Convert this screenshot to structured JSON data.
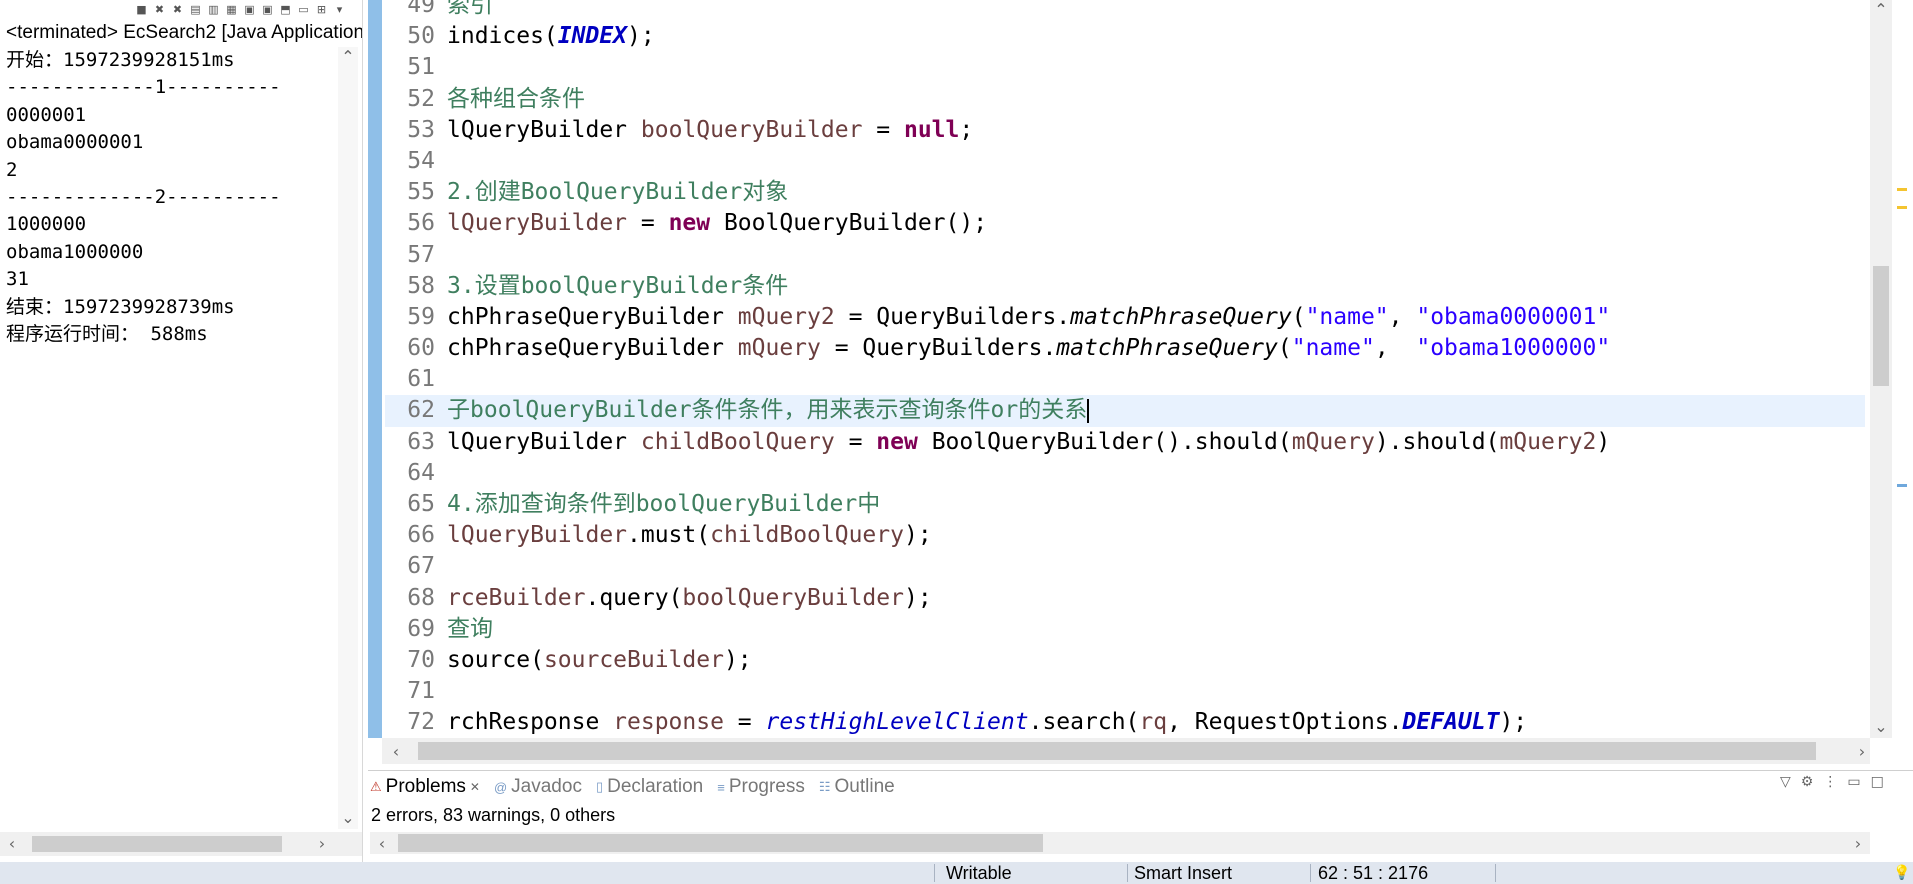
{
  "console": {
    "title": "<terminated> EcSearch2 [Java Application",
    "toolbar_icons": [
      "terminate-icon",
      "remove-launch-icon",
      "remove-all-icon",
      "clear-console-icon",
      "scroll-lock-icon",
      "word-wrap-icon",
      "show-on-output-icon",
      "show-on-error-icon",
      "pin-console-icon",
      "display-selected-icon",
      "open-console-icon",
      "view-menu-icon"
    ],
    "lines": [
      "开始：1597239928151ms",
      "-------------1----------",
      "0000001",
      "obama0000001",
      "2",
      "-------------2----------",
      "1000000",
      "obama1000000",
      "31",
      "结束：1597239928739ms",
      "程序运行时间： 588ms"
    ]
  },
  "editor": {
    "current_line": "62",
    "lines": [
      {
        "n": "49",
        "p": [
          [
            "cm",
            "索引"
          ]
        ]
      },
      {
        "n": "50",
        "p": [
          [
            "tx",
            "indices("
          ],
          [
            "sfld",
            "INDEX"
          ],
          [
            "tx",
            ");"
          ]
        ]
      },
      {
        "n": "51",
        "p": []
      },
      {
        "n": "52",
        "p": [
          [
            "cm",
            "各种组合条件"
          ]
        ]
      },
      {
        "n": "53",
        "p": [
          [
            "tx",
            "lQueryBuilder "
          ],
          [
            "var",
            "boolQueryBuilder"
          ],
          [
            "tx",
            " = "
          ],
          [
            "kw",
            "null"
          ],
          [
            "tx",
            ";"
          ]
        ]
      },
      {
        "n": "54",
        "p": []
      },
      {
        "n": "55",
        "p": [
          [
            "cm",
            "2.创建BoolQueryBuilder对象"
          ]
        ]
      },
      {
        "n": "56",
        "p": [
          [
            "var",
            "lQueryBuilder"
          ],
          [
            "tx",
            " = "
          ],
          [
            "kw",
            "new"
          ],
          [
            "tx",
            " BoolQueryBuilder();"
          ]
        ]
      },
      {
        "n": "57",
        "p": []
      },
      {
        "n": "58",
        "p": [
          [
            "cm",
            "3.设置boolQueryBuilder条件"
          ]
        ]
      },
      {
        "n": "59",
        "p": [
          [
            "tx",
            "chPhraseQueryBuilder "
          ],
          [
            "var",
            "mQuery2"
          ],
          [
            "tx",
            " = QueryBuilders."
          ],
          [
            "it",
            "matchPhraseQuery"
          ],
          [
            "tx",
            "("
          ],
          [
            "st",
            "\"name\""
          ],
          [
            "tx",
            ", "
          ],
          [
            "st",
            "\"obama0000001\""
          ]
        ]
      },
      {
        "n": "60",
        "p": [
          [
            "tx",
            "chPhraseQueryBuilder "
          ],
          [
            "var",
            "mQuery"
          ],
          [
            "tx",
            " = QueryBuilders."
          ],
          [
            "it",
            "matchPhraseQuery"
          ],
          [
            "tx",
            "("
          ],
          [
            "st",
            "\"name\""
          ],
          [
            "tx",
            ",  "
          ],
          [
            "st",
            "\"obama1000000\""
          ]
        ]
      },
      {
        "n": "61",
        "p": []
      },
      {
        "n": "62",
        "p": [
          [
            "cm",
            "子boolQueryBuilder条件条件，用来表示查询条件or的关系"
          ],
          [
            "caret",
            ""
          ]
        ]
      },
      {
        "n": "63",
        "p": [
          [
            "tx",
            "lQueryBuilder "
          ],
          [
            "var",
            "childBoolQuery"
          ],
          [
            "tx",
            " = "
          ],
          [
            "kw",
            "new"
          ],
          [
            "tx",
            " BoolQueryBuilder().should("
          ],
          [
            "var",
            "mQuery"
          ],
          [
            "tx",
            ").should("
          ],
          [
            "var",
            "mQuery2"
          ],
          [
            "tx",
            ")"
          ]
        ]
      },
      {
        "n": "64",
        "p": []
      },
      {
        "n": "65",
        "p": [
          [
            "cm",
            "4.添加查询条件到boolQueryBuilder中"
          ]
        ]
      },
      {
        "n": "66",
        "p": [
          [
            "var",
            "lQueryBuilder"
          ],
          [
            "tx",
            ".must("
          ],
          [
            "var",
            "childBoolQuery"
          ],
          [
            "tx",
            ");"
          ]
        ]
      },
      {
        "n": "67",
        "p": []
      },
      {
        "n": "68",
        "p": [
          [
            "var",
            "rceBuilder"
          ],
          [
            "tx",
            ".query("
          ],
          [
            "var",
            "boolQueryBuilder"
          ],
          [
            "tx",
            ");"
          ]
        ]
      },
      {
        "n": "69",
        "p": [
          [
            "cm",
            "查询"
          ]
        ]
      },
      {
        "n": "70",
        "p": [
          [
            "tx",
            "source("
          ],
          [
            "var",
            "sourceBuilder"
          ],
          [
            "tx",
            ");"
          ]
        ]
      },
      {
        "n": "71",
        "p": []
      },
      {
        "n": "72",
        "p": [
          [
            "tx",
            "rchResponse "
          ],
          [
            "var",
            "response"
          ],
          [
            "tx",
            " = "
          ],
          [
            "sit",
            "restHighLevelClient"
          ],
          [
            "tx",
            ".search("
          ],
          [
            "var",
            "rq"
          ],
          [
            "tx",
            ", RequestOptions."
          ],
          [
            "sfld",
            "DEFAULT"
          ],
          [
            "tx",
            ");"
          ]
        ]
      }
    ]
  },
  "bottom_panel": {
    "tabs": [
      {
        "label": "Problems",
        "icon": "problems-icon",
        "active": true,
        "closable": true
      },
      {
        "label": "Javadoc",
        "icon": "javadoc-icon",
        "active": false
      },
      {
        "label": "Declaration",
        "icon": "declaration-icon",
        "active": false
      },
      {
        "label": "Progress",
        "icon": "progress-icon",
        "active": false
      },
      {
        "label": "Outline",
        "icon": "outline-icon",
        "active": false
      }
    ],
    "summary": "2 errors, 83 warnings, 0 others"
  },
  "status_bar": {
    "mode": "Writable",
    "insert_mode": "Smart Insert",
    "position": "62 : 51 : 2176"
  }
}
